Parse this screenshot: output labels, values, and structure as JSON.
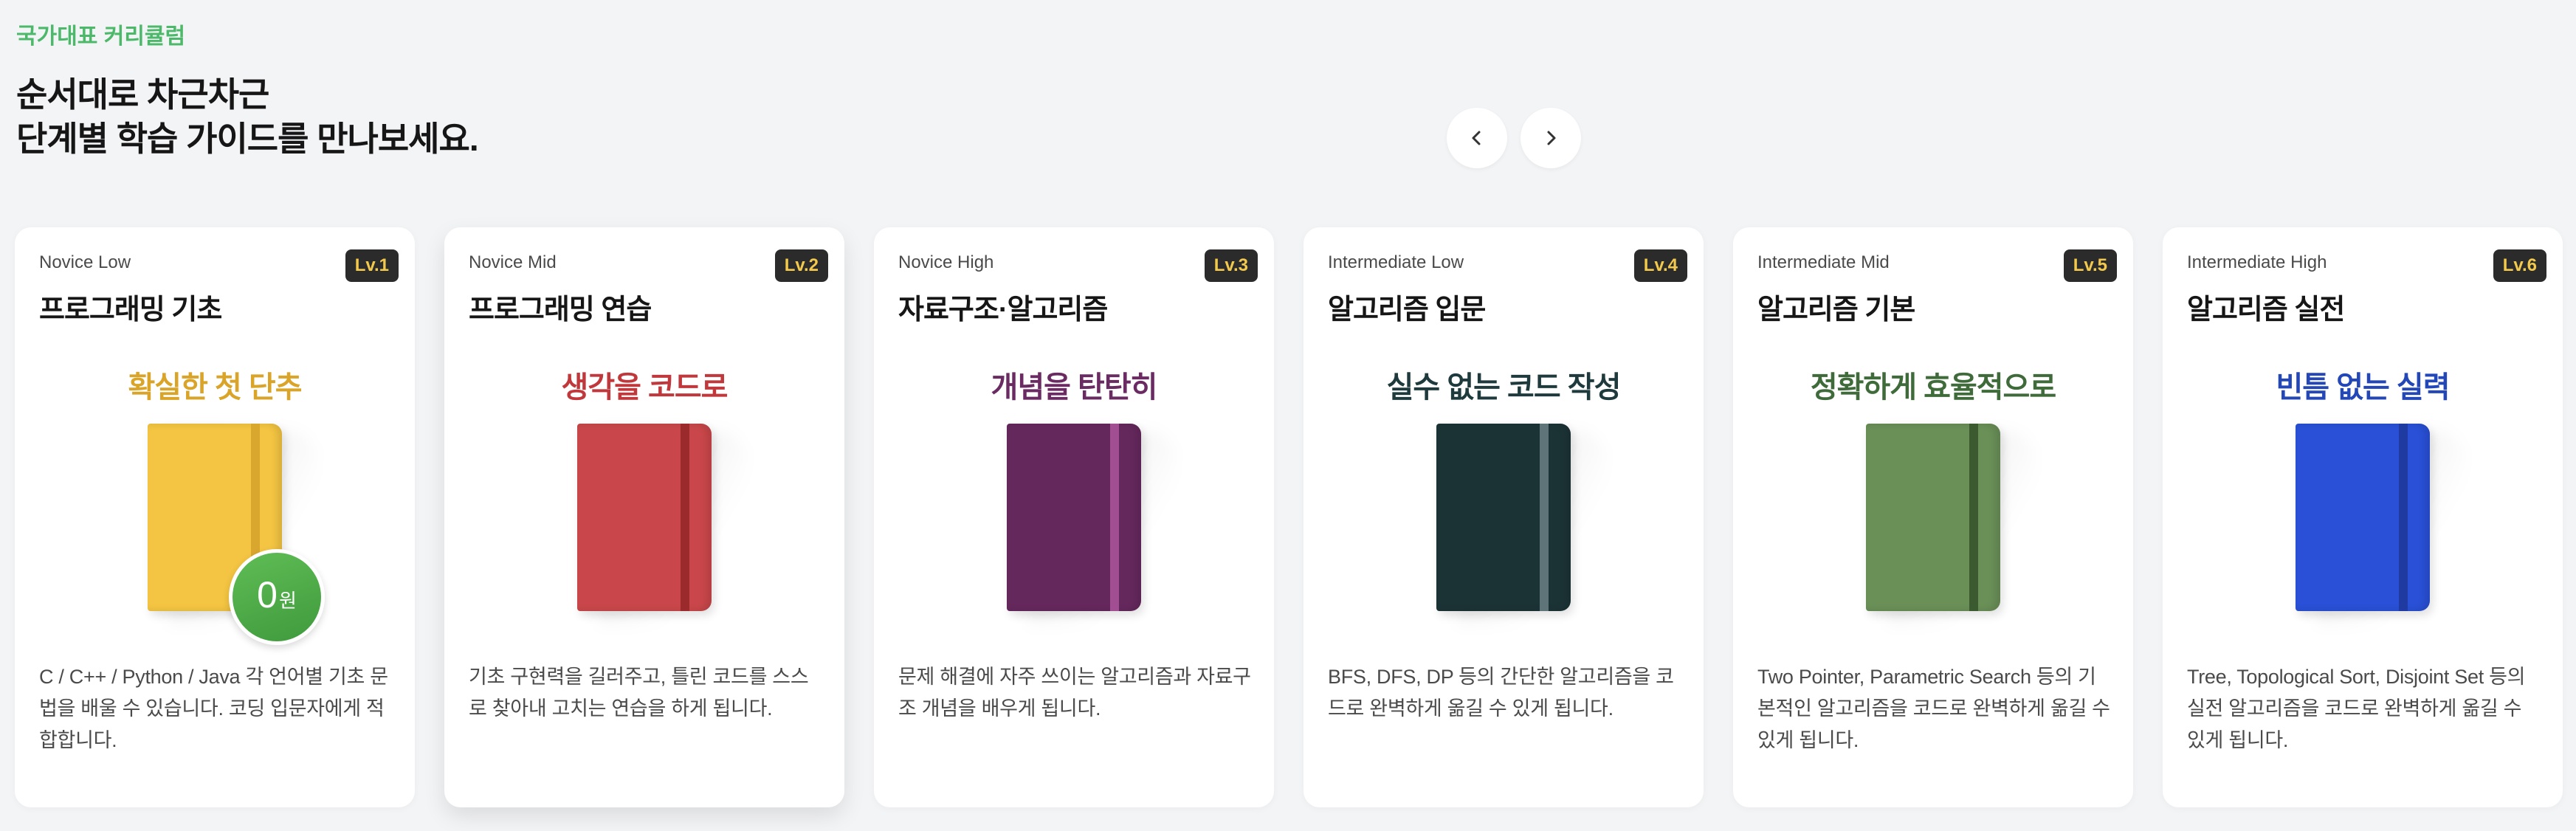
{
  "header": {
    "eyebrow": "국가대표 커리큘럼",
    "headline_line1": "순서대로 차근차근",
    "headline_line2": "단계별 학습 가이드를 만나보세요."
  },
  "nav": {
    "prev_icon": "chevron-left-icon",
    "next_icon": "chevron-right-icon"
  },
  "cards": [
    {
      "level_name": "Novice Low",
      "badge": "Lv.1",
      "title": "프로그래밍 기초",
      "slogan": "확실한 첫 단추",
      "slogan_color": "#d9a428",
      "book_color": "#f4c542",
      "band_color": "#d9a72e",
      "price": "0",
      "price_unit": "원",
      "description": "C / C++ / Python / Java 각 언어별 기초 문법을 배울 수 있습니다. 코딩 입문자에게 적합합니다."
    },
    {
      "level_name": "Novice Mid",
      "badge": "Lv.2",
      "title": "프로그래밍 연습",
      "slogan": "생각을 코드로",
      "slogan_color": "#c0383b",
      "book_color": "#c9474a",
      "band_color": "#9a2a2c",
      "description": "기초 구현력을 길러주고, 틀린 코드를 스스로 찾아내 고치는 연습을 하게 됩니다."
    },
    {
      "level_name": "Novice High",
      "badge": "Lv.3",
      "title": "자료구조·알고리즘",
      "slogan": "개념을 탄탄히",
      "slogan_color": "#6a2a62",
      "book_color": "#65285d",
      "band_color": "#a24e93",
      "description": "문제 해결에 자주 쓰이는 알고리즘과 자료구조 개념을 배우게 됩니다."
    },
    {
      "level_name": "Intermediate Low",
      "badge": "Lv.4",
      "title": "알고리즘 입문",
      "slogan": "실수 없는 코드 작성",
      "slogan_color": "#1f3a3c",
      "book_color": "#1c3336",
      "band_color": "#5e7478",
      "description": "BFS, DFS, DP 등의 간단한 알고리즘을 코드로 완벽하게 옮길 수 있게 됩니다."
    },
    {
      "level_name": "Intermediate Mid",
      "badge": "Lv.5",
      "title": "알고리즘 기본",
      "slogan": "정확하게 효율적으로",
      "slogan_color": "#3f6a3a",
      "book_color": "#6a8f57",
      "band_color": "#3c5a2f",
      "description": "Two Pointer, Parametric Search 등의 기본적인 알고리즘을 코드로 완벽하게 옮길 수 있게 됩니다."
    },
    {
      "level_name": "Intermediate High",
      "badge": "Lv.6",
      "title": "알고리즘 실전",
      "slogan": "빈틈 없는 실력",
      "slogan_color": "#2447b8",
      "book_color": "#2950d6",
      "band_color": "#1f3aa0",
      "description": "Tree, Topological Sort, Disjoint Set 등의 실전 알고리즘을 코드로 완벽하게 옮길 수 있게 됩니다."
    }
  ]
}
